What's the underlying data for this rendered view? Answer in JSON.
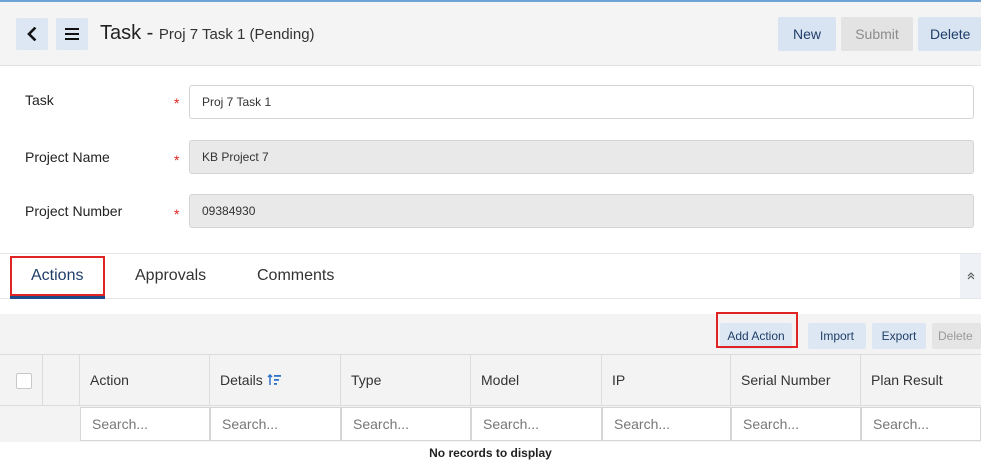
{
  "header": {
    "title": "Task",
    "separator": " - ",
    "subtitle": "Proj 7 Task 1 (Pending)",
    "new_label": "New",
    "submit_label": "Submit",
    "delete_label": "Delete",
    "back_icon": "chevron-left-icon",
    "menu_icon": "hamburger-menu-icon"
  },
  "form": {
    "fields": [
      {
        "label": "Task",
        "required": "*",
        "value": "Proj 7 Task 1",
        "readonly": false
      },
      {
        "label": "Project Name",
        "required": "*",
        "value": "KB Project 7",
        "readonly": true
      },
      {
        "label": "Project Number",
        "required": "*",
        "value": "09384930",
        "readonly": true
      }
    ]
  },
  "tabs": {
    "items": [
      {
        "label": "Actions",
        "active": true
      },
      {
        "label": "Approvals",
        "active": false
      },
      {
        "label": "Comments",
        "active": false
      }
    ],
    "collapse_icon": "double-chevron-up-icon"
  },
  "toolbar": {
    "add_action_label": "Add Action",
    "import_label": "Import",
    "export_label": "Export",
    "delete_label": "Delete"
  },
  "table": {
    "columns": [
      "Action",
      "Details",
      "Type",
      "Model",
      "IP",
      "Serial Number",
      "Plan Result"
    ],
    "search_placeholder": "Search...",
    "empty_message": "No records to display",
    "sort_icon": "sort-icon"
  },
  "colors": {
    "accent": "#1f4a8a",
    "button_bg": "#d9e4f2",
    "highlight": "#e02424",
    "required": "#dd2222"
  }
}
